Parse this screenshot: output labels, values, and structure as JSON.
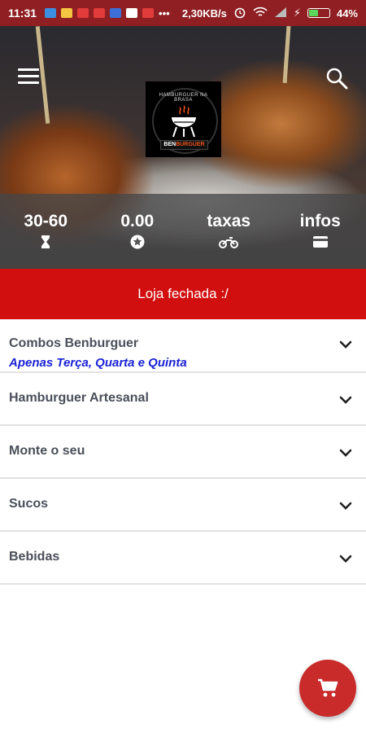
{
  "status_bar": {
    "time": "11:31",
    "network_speed": "2,30KB/s",
    "battery": "44%",
    "battery_level": 0.44
  },
  "header": {
    "logo_alt": "HAMBURGUER NA BRASA",
    "logo_brand_prefix": "BEN",
    "logo_brand_suffix": "BURGUER"
  },
  "stats": [
    {
      "value": "30-60",
      "icon": "hourglass-icon"
    },
    {
      "value": "0.00",
      "icon": "star-icon"
    },
    {
      "value": "taxas",
      "icon": "motorcycle-icon"
    },
    {
      "value": "infos",
      "icon": "credit-card-icon"
    }
  ],
  "banner": {
    "text": "Loja fechada :/",
    "color": "#d20f0f"
  },
  "categories": [
    {
      "name": "Combos Benburguer",
      "subtitle": "Apenas Terça, Quarta e Quinta"
    },
    {
      "name": "Hamburguer Artesanal"
    },
    {
      "name": "Monte o seu"
    },
    {
      "name": "Sucos"
    },
    {
      "name": "Bebidas"
    }
  ],
  "colors": {
    "status_bar": "#8f1f22",
    "accent": "#c92a2a",
    "subtitle": "#1a22d6"
  }
}
